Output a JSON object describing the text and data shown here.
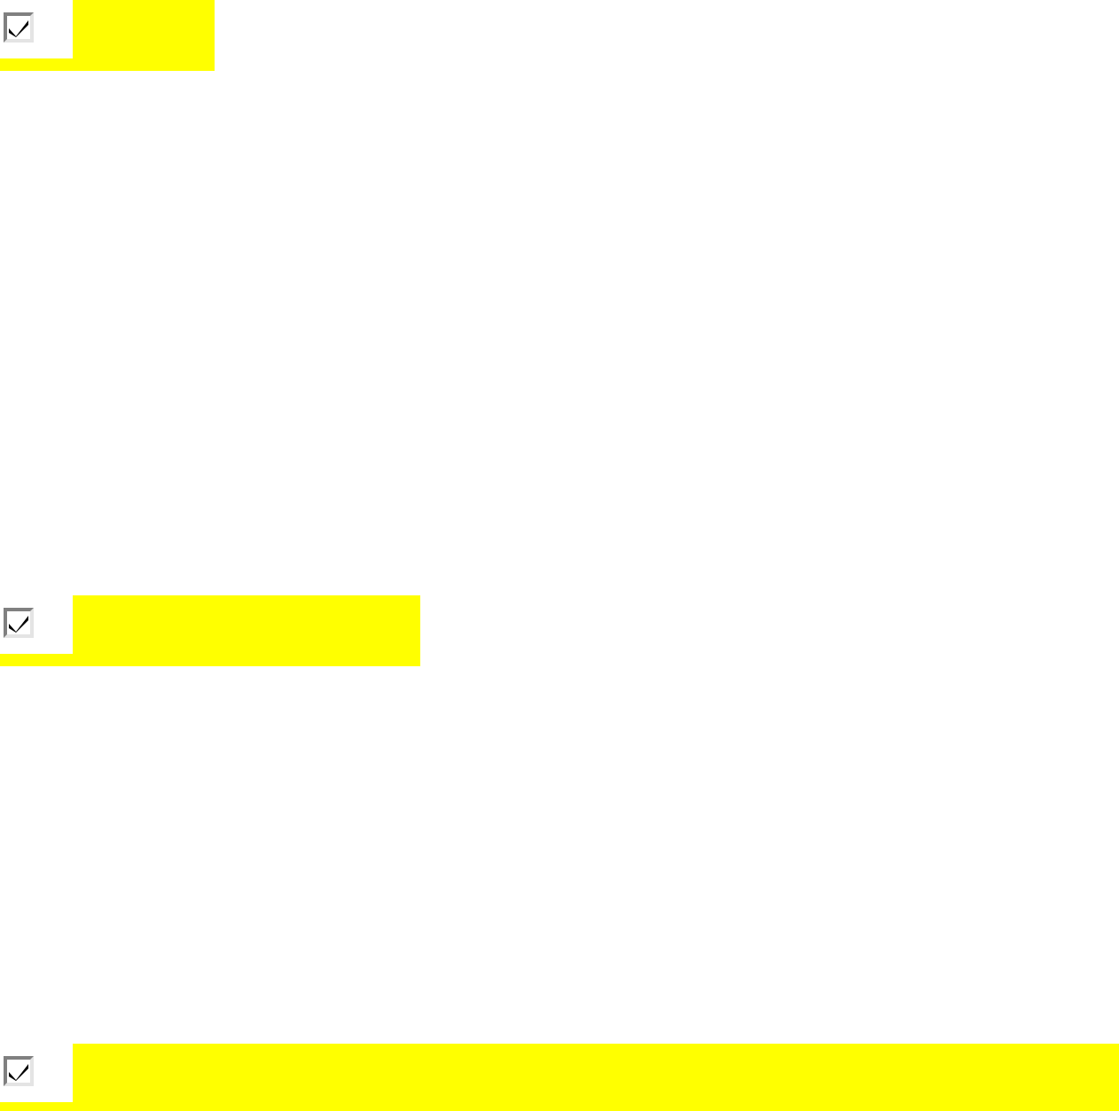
{
  "checkboxes": [
    {
      "checked": true
    },
    {
      "checked": true
    },
    {
      "checked": true
    }
  ]
}
